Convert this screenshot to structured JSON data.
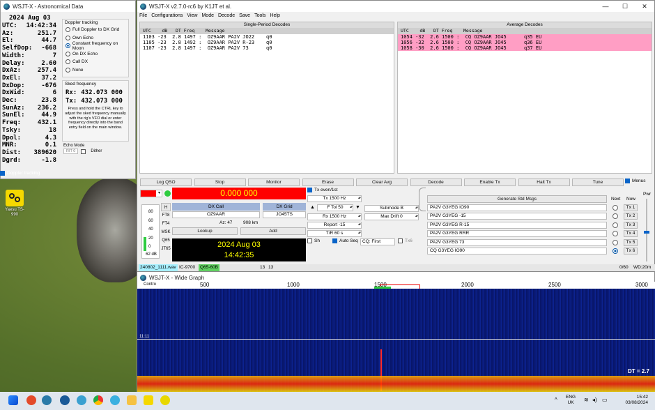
{
  "desktop": {
    "icon_label": "Yaesu TS-990"
  },
  "astro": {
    "title": "WSJT-X - Astronomical Data",
    "date": "2024 Aug 03",
    "rows": [
      {
        "k": "UTC:",
        "v": "14:42:34"
      },
      {
        "k": "Az:",
        "v": "251.7"
      },
      {
        "k": "El:",
        "v": "44.7"
      },
      {
        "k": "SelfDop:",
        "v": "-668"
      },
      {
        "k": "Width:",
        "v": "7"
      },
      {
        "k": "Delay:",
        "v": "2.60"
      },
      {
        "k": "DxAz:",
        "v": "257.4"
      },
      {
        "k": "DxEl:",
        "v": "37.2"
      },
      {
        "k": "DxDop:",
        "v": "-676"
      },
      {
        "k": "DxWid:",
        "v": "6"
      },
      {
        "k": "Dec:",
        "v": "23.8"
      },
      {
        "k": "SunAz:",
        "v": "236.2"
      },
      {
        "k": "SunEl:",
        "v": "44.9"
      },
      {
        "k": "Freq:",
        "v": "432.1"
      },
      {
        "k": "Tsky:",
        "v": "18"
      },
      {
        "k": "Dpol:",
        "v": "4.3"
      },
      {
        "k": "MNR:",
        "v": "0.1"
      },
      {
        "k": "Dist:",
        "v": "389620"
      },
      {
        "k": "Dgrd:",
        "v": "-1.8"
      }
    ],
    "doppler_title": "Doppler tracking",
    "doppler_options": [
      "Full Doppler to DX Grid",
      "Own Echo",
      "Constant frequency on Moon",
      "On DX Echo",
      "Call DX",
      "None"
    ],
    "doppler_selected": 2,
    "sked_title": "Sked frequency",
    "rx_label": "Rx:",
    "rx_value": "432.073 000",
    "tx_label": "Tx:",
    "tx_value": "432.073 000",
    "sked_help": "Press and hold the CTRL key to adjust the sked frequency manually with the rig's VFO dial or enter frequency directly into the band entry field on the main window.",
    "echo_title": "Echo Mode",
    "echo_rit": "RIT 0",
    "dither_label": "Dither",
    "doppler_chk_label": "Doppler tracking"
  },
  "main": {
    "title": "WSJT-X   v2.7.0-rc6   by K1JT et al.",
    "menu": [
      "File",
      "Configurations",
      "View",
      "Mode",
      "Decode",
      "Save",
      "Tools",
      "Help"
    ],
    "single_title": "Single-Period Decodes",
    "average_title": "Average Decodes",
    "col_header": "UTC    dB   DT Freq    Message",
    "single_rows": [
      "1103 -23  2.8 1497 :  OZ9AAR PA2V JO22    q0",
      "1105 -23  2.8 1492 :  OZ9AAR PA2V R-23    q0",
      "1107 -23  2.8 1497 :  OZ9AAR PA2V 73      q0"
    ],
    "average_rows": [
      "1054 -32  2.6 1500 :  CQ OZ9AAR JO45      q35 EU",
      "1056 -32  2.6 1500 :  CQ OZ9AAR JO45      q36 EU",
      "1058 -30  2.6 1500 :  CQ OZ9AAR JO45      q37 EU"
    ],
    "buttons": [
      "Log QSO",
      "Stop",
      "Monitor",
      "Erase",
      "Clear Avg",
      "Decode",
      "Enable Tx",
      "Halt Tx",
      "Tune"
    ],
    "menus_label": "Menus",
    "dial_freq": "0.000 000",
    "meter_ticks": [
      "80",
      "60",
      "40",
      "20",
      "0"
    ],
    "meter_db": "62 dB",
    "mode_btns": [
      "H",
      "FT8",
      "FT4",
      "MSK",
      "Q65",
      "JT65"
    ],
    "dxcall_label": "DX Call",
    "dxgrid_label": "DX Grid",
    "dxcall": "OZ9AAR",
    "dxgrid": "JO45TS",
    "az": "Az: 47",
    "dist": "908 km",
    "lookup": "Lookup",
    "add": "Add",
    "clock_date": "2024 Aug 03",
    "clock_time": "14:42:35",
    "tx_even": "Tx even/1st",
    "tx_hz": "Tx  1500  Hz",
    "ftol": "F Tol  50",
    "rx_hz": "Rx  1500  Hz",
    "report": "Report -15",
    "tr": "T/R  60  s",
    "submode": "Submode B",
    "maxdrift": "Max Drift  0",
    "sh": "Sh",
    "autoseq": "Auto Seq",
    "cq": "CQ: First",
    "tx6": "Tx6",
    "gen_std": "Generate Std Msgs",
    "next": "Next",
    "now": "Now",
    "msgs": [
      "PA2V G3YEG IO90",
      "PA2V G3YEG -15",
      "PA2V G3YEG R-15",
      "PA2V G3YEG RRR",
      "PA2V G3YEG 73",
      "CQ G3YEG IO90"
    ],
    "tx_labels": [
      "Tx 1",
      "Tx 2",
      "Tx 3",
      "Tx 4",
      "Tx 5",
      "Tx 6"
    ],
    "next_selected": 5,
    "pwr": "Pwr",
    "status": [
      "240802_1111.wav",
      "IC-9700",
      "Q65-60B",
      "13",
      "13"
    ],
    "status_right": [
      "0/60",
      "WD:20m"
    ]
  },
  "wide": {
    "title": "WSJT-X - Wide Graph",
    "contro": "Contro",
    "ticks": [
      "500",
      "1000",
      "1500",
      "2000",
      "2500",
      "3000"
    ],
    "time_mark": "11:11",
    "dt": "DT = 2.7"
  },
  "taskbar": {
    "lang": "ENG",
    "region": "UK",
    "time": "15:42",
    "date": "03/08/2024"
  },
  "colors": {
    "dial_red": "#ff0000",
    "clock_bg": "#000000",
    "clock_fg": "#ffff00",
    "pink": "#ff9ec4",
    "dxbtn": "#a0b4d8",
    "waterfall": "#0a1b7a"
  }
}
